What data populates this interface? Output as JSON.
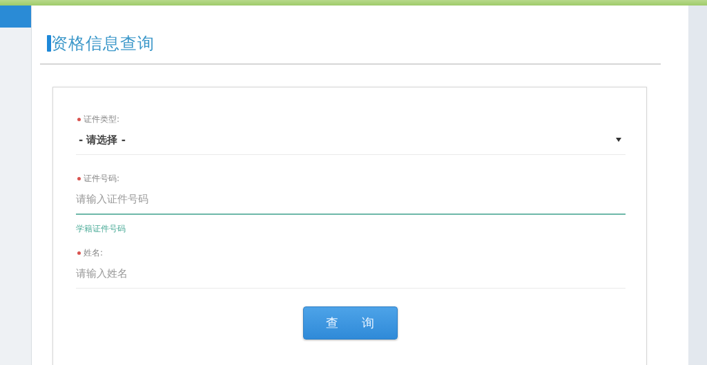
{
  "title": "资格信息查询",
  "fields": [
    {
      "kind": "select",
      "label": "证件类型:",
      "required": true,
      "value": "- 请选择 -",
      "focused": false
    },
    {
      "kind": "input",
      "label": "证件号码:",
      "required": true,
      "placeholder": "请输入证件号码",
      "focused": true,
      "hint": "学籍证件号码"
    },
    {
      "kind": "input",
      "label": "姓名:",
      "required": true,
      "placeholder": "请输入姓名",
      "focused": false
    }
  ],
  "submit_button": "查 询"
}
